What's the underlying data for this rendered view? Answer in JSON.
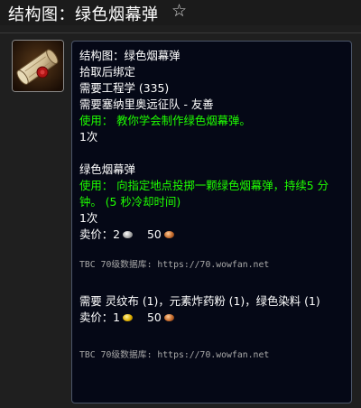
{
  "header": {
    "title": "结构图：绿色烟幕弹",
    "star_icon": "star-outline-icon"
  },
  "item_icon": "smoke-bomb-schematic-icon",
  "tooltip": {
    "name": "结构图：绿色烟幕弹",
    "bind_type": "拾取后绑定",
    "req_skill": "需要工程学 (335)",
    "req_faction": "需要塞纳里奥远征队 - 友善",
    "use_text": "使用： 教你学会制作绿色烟幕弹。",
    "charges": "1次",
    "product": {
      "name": "绿色烟幕弹",
      "use_text": "使用： 向指定地点投掷一颗绿色烟幕弹，持续5 分钟。 (5 秒冷却时间)",
      "charges": "1次",
      "sell_label": "卖价：",
      "sell_silver": "2",
      "sell_copper": "50"
    },
    "source1": "TBC 70级数据库: https://70.wowfan.net",
    "reagents": "需要 灵纹布 (1)，元素炸药粉 (1)，绿色染料 (1)",
    "sell": {
      "label": "卖价：",
      "gold": "1",
      "copper": "50"
    },
    "source2": "TBC 70级数据库: https://70.wowfan.net"
  },
  "colors": {
    "use_text": "#1eff00",
    "tooltip_bg": "#050816",
    "page_bg": "#1f1f1f"
  }
}
